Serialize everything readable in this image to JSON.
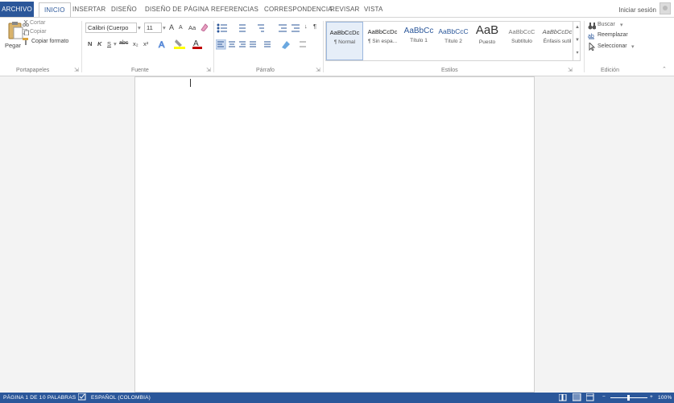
{
  "tabs": {
    "archivo": "ARCHIVO",
    "inicio": "INICIO",
    "insertar": "INSERTAR",
    "diseno": "DISEÑO",
    "diseno_pagina": "DISEÑO DE PÁGINA",
    "referencias": "REFERENCIAS",
    "correspondencia": "CORRESPONDENCIA",
    "revisar": "REVISAR",
    "vista": "VISTA"
  },
  "account": {
    "signin": "Iniciar sesión"
  },
  "clipboard": {
    "paste": "Pegar",
    "cut": "Cortar",
    "copy": "Copiar",
    "format_painter": "Copiar formato",
    "label": "Portapapeles"
  },
  "font": {
    "name": "Calibri (Cuerpo",
    "size": "11",
    "bold": "N",
    "italic": "K",
    "underline": "S",
    "strike": "abc",
    "subscript": "x₂",
    "superscript": "x²",
    "grow": "A",
    "shrink": "A",
    "case": "Aa",
    "label": "Fuente"
  },
  "paragraph": {
    "marks": "¶",
    "sort": "↓",
    "label": "Párrafo"
  },
  "styles": {
    "items": [
      {
        "preview": "AaBbCcDc",
        "name": "¶ Normal"
      },
      {
        "preview": "AaBbCcDc",
        "name": "¶ Sin espa..."
      },
      {
        "preview": "AaBbCc",
        "name": "Título 1"
      },
      {
        "preview": "AaBbCcC",
        "name": "Título 2"
      },
      {
        "preview": "AaB",
        "name": "Puesto"
      },
      {
        "preview": "AaBbCcC",
        "name": "Subtítulo"
      },
      {
        "preview": "AaBbCcDc",
        "name": "Énfasis sutil"
      }
    ],
    "label": "Estilos"
  },
  "editing": {
    "find": "Buscar",
    "replace": "Reemplazar",
    "select": "Seleccionar",
    "label": "Edición"
  },
  "status": {
    "page": "PÁGINA 1 DE 1",
    "words": "0 PALABRAS",
    "language": "ESPAÑOL (COLOMBIA)",
    "zoom": "100%"
  },
  "colors": {
    "accent": "#2b579a",
    "highlight": "#ffff00",
    "font_color": "#c00000"
  }
}
